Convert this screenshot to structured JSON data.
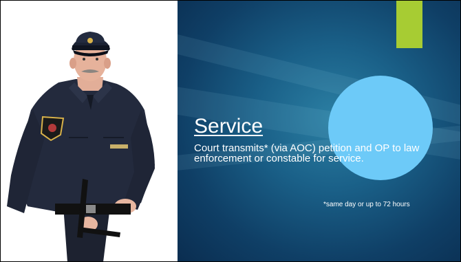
{
  "slide": {
    "title": "Service",
    "body": "Court transmits* (via AOC) petition and OP to law enforcement or constable for service.",
    "footnote": "*same day or up to 72 hours"
  },
  "image": {
    "description": "police officer"
  },
  "colors": {
    "background_dark": "#0f3f66",
    "background_mid": "#1a6088",
    "accent_bar": "#a7cc33",
    "circle": "#6dcaf8",
    "text": "#ffffff"
  }
}
